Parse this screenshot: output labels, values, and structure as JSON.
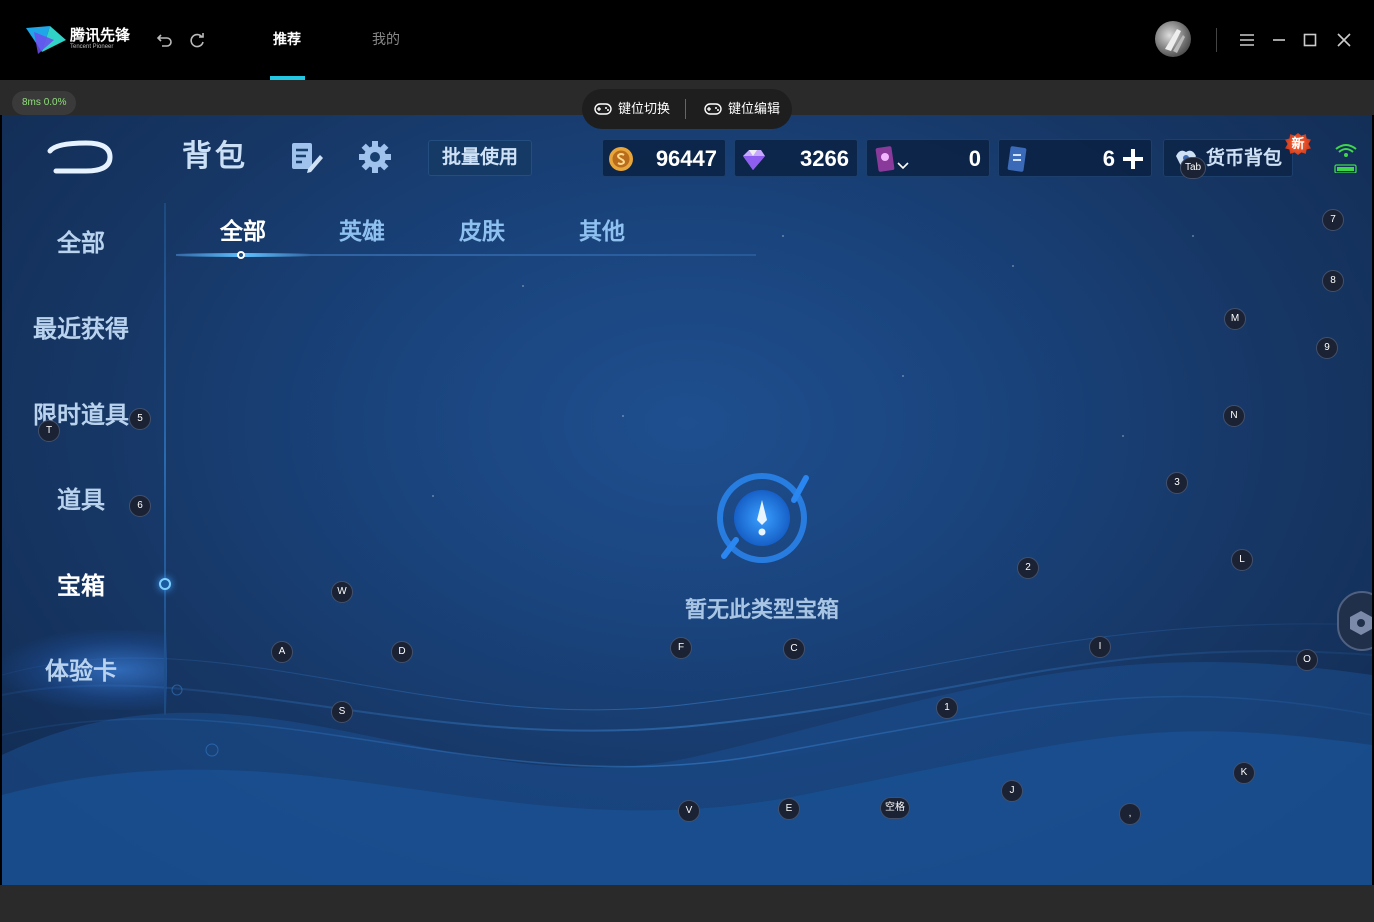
{
  "titlebar": {
    "logo_text": "腾讯先锋",
    "logo_sub": "Tencent Pioneer",
    "tabs": [
      {
        "label": "推荐",
        "active": true
      },
      {
        "label": "我的",
        "active": false
      }
    ],
    "accent_color": "#23c7e2"
  },
  "statusbar": {
    "ping": "8ms",
    "loss": "0.0%"
  },
  "keybar": {
    "switch_label": "键位切换",
    "edit_label": "键位编辑"
  },
  "game": {
    "title": "背包",
    "batch_label": "批量使用",
    "currencies": [
      {
        "icon": "gold-coin-icon",
        "value": "96447"
      },
      {
        "icon": "diamond-icon",
        "value": "3266"
      },
      {
        "icon": "card-voucher-icon",
        "value": "0"
      },
      {
        "icon": "ticket-icon",
        "value": "6"
      }
    ],
    "wallet_label": "货币背包",
    "new_badge": "新",
    "sidebar": [
      {
        "label": "全部",
        "active": false
      },
      {
        "label": "最近获得",
        "active": false
      },
      {
        "label": "限时道具",
        "active": false
      },
      {
        "label": "道具",
        "active": false
      },
      {
        "label": "宝箱",
        "active": true
      },
      {
        "label": "体验卡",
        "active": false
      }
    ],
    "tabs": [
      {
        "label": "全部",
        "active": true
      },
      {
        "label": "英雄",
        "active": false
      },
      {
        "label": "皮肤",
        "active": false
      },
      {
        "label": "其他",
        "active": false
      }
    ],
    "empty_text": "暂无此类型宝箱"
  },
  "key_overlays": [
    "Tab",
    "7",
    "8",
    "M",
    "9",
    "N",
    "T",
    "5",
    "6",
    "3",
    "2",
    "L",
    "W",
    "A",
    "D",
    "F",
    "C",
    "I",
    "O",
    "S",
    "1",
    "K",
    "V",
    "E",
    "空格",
    "J",
    ","
  ]
}
